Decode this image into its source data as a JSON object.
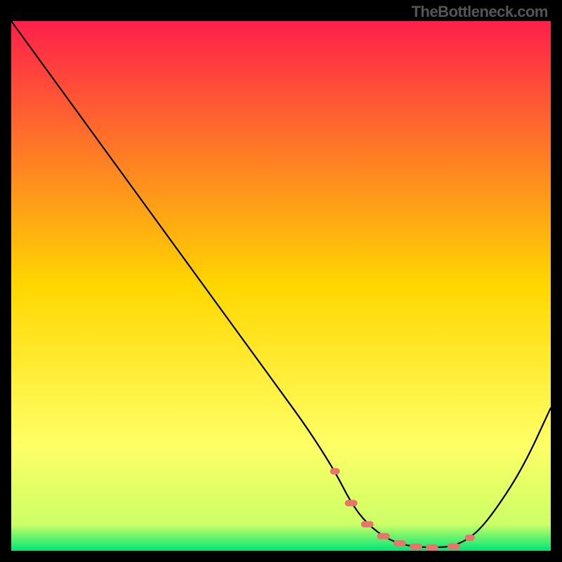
{
  "watermark": "TheBottleneck.com",
  "chart_data": {
    "type": "line",
    "title": "",
    "xlabel": "",
    "ylabel": "",
    "xlim": [
      0,
      100
    ],
    "ylim": [
      0,
      100
    ],
    "background": {
      "type": "vertical-gradient",
      "stops": [
        {
          "offset": 0,
          "color": "#ff1f4b"
        },
        {
          "offset": 50,
          "color": "#ffd700"
        },
        {
          "offset": 80,
          "color": "#ffff66"
        },
        {
          "offset": 95,
          "color": "#ccff66"
        },
        {
          "offset": 100,
          "color": "#00e676"
        }
      ]
    },
    "series": [
      {
        "name": "bottleneck-curve",
        "color": "#000000",
        "x": [
          0,
          5,
          10,
          15,
          20,
          25,
          30,
          35,
          40,
          45,
          50,
          55,
          60,
          63,
          66,
          70,
          74,
          78,
          82,
          86,
          90,
          95,
          100
        ],
        "values": [
          100,
          93,
          86,
          79,
          72,
          65,
          58,
          51,
          44,
          37,
          30,
          23,
          15,
          9,
          5,
          2,
          0.8,
          0.6,
          0.8,
          3,
          8,
          16,
          27
        ]
      }
    ],
    "markers": {
      "name": "highlight-dashes",
      "color": "#e8746b",
      "style": "dash-segments",
      "x_positions": [
        60,
        63,
        66,
        69,
        72,
        75,
        78,
        82,
        85
      ],
      "y_level": 3
    }
  }
}
